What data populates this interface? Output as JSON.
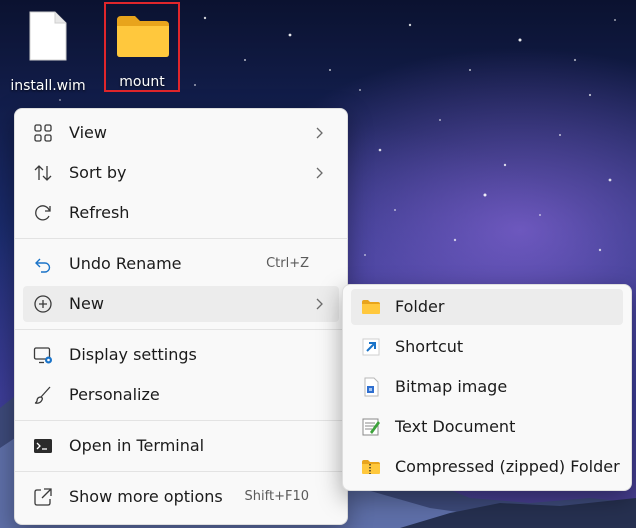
{
  "desktop": {
    "icons": [
      {
        "label": "install.wim"
      },
      {
        "label": "mount"
      }
    ]
  },
  "context_menu": {
    "items": [
      {
        "label": "View",
        "icon": "grid-icon"
      },
      {
        "label": "Sort by",
        "icon": "sort-arrows-icon"
      },
      {
        "label": "Refresh",
        "icon": "refresh-icon"
      },
      {
        "label": "Undo Rename",
        "icon": "undo-icon",
        "shortcut": "Ctrl+Z"
      },
      {
        "label": "New",
        "icon": "new-plus-icon"
      },
      {
        "label": "Display settings",
        "icon": "display-settings-icon"
      },
      {
        "label": "Personalize",
        "icon": "brush-icon"
      },
      {
        "label": "Open in Terminal",
        "icon": "terminal-icon"
      },
      {
        "label": "Show more options",
        "icon": "share-icon",
        "shortcut": "Shift+F10"
      }
    ]
  },
  "new_submenu": {
    "items": [
      {
        "label": "Folder",
        "icon": "folder-icon"
      },
      {
        "label": "Shortcut",
        "icon": "shortcut-icon"
      },
      {
        "label": "Bitmap image",
        "icon": "bitmap-icon"
      },
      {
        "label": "Text Document",
        "icon": "text-document-icon"
      },
      {
        "label": "Compressed (zipped) Folder",
        "icon": "zip-folder-icon"
      }
    ]
  },
  "colors": {
    "highlight": "#ececec",
    "selection_border": "#e0262b",
    "accent": "#0067c0"
  }
}
